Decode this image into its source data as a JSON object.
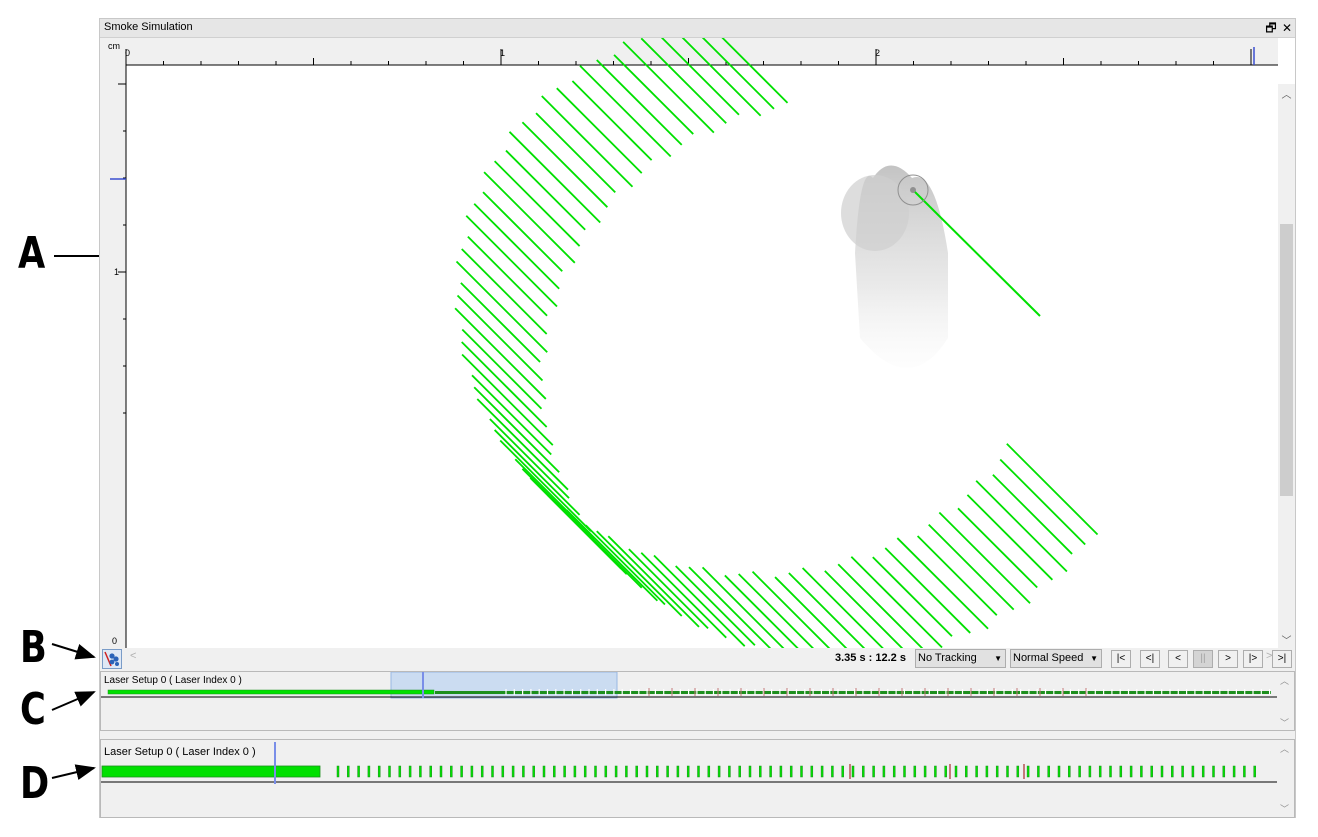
{
  "window": {
    "title": "Smoke Simulation",
    "restore_icon": "restore-icon",
    "close_icon": "close-icon",
    "restore_glyph": "🗗",
    "close_glyph": "✕"
  },
  "ruler": {
    "unit": "cm",
    "x_labels": [
      "0",
      "1",
      "2"
    ],
    "y_labels": [
      "1",
      "0"
    ]
  },
  "playback": {
    "time_display": "3.35 s : 12.2 s",
    "tracking": "No Tracking",
    "speed": "Normal Speed",
    "controls": [
      "|<",
      "<|",
      "<",
      "||",
      ">",
      "|>",
      ">|"
    ]
  },
  "timeline_overview": {
    "track_label": "Laser Setup 0 ( Laser Index 0 )"
  },
  "timeline_detail": {
    "track_label": "Laser Setup 0 ( Laser Index 0 )"
  },
  "annotations": [
    "A",
    "B",
    "C",
    "D"
  ],
  "colors": {
    "laser": "#00e000",
    "laser_dark": "#1d8f1d",
    "marker": "#c47a7a",
    "playhead": "#7a8ee8",
    "selection": "#c5d9f2"
  }
}
